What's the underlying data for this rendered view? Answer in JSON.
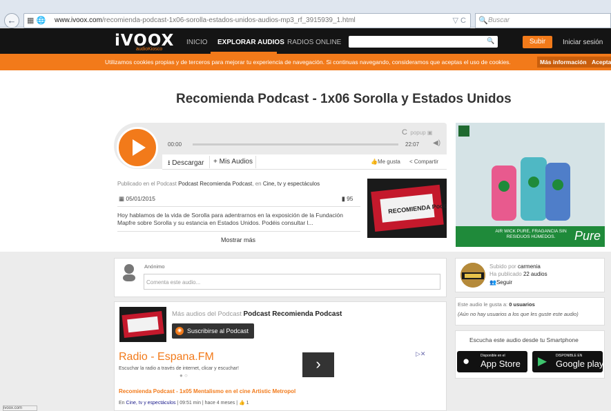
{
  "browser": {
    "url_domain": "www.ivoox.com",
    "url_path": "/recomienda-podcast-1x06-sorolla-estados-unidos-audios-mp3_rf_3915939_1.html",
    "search_placeholder": "Buscar",
    "back_glyph": "←",
    "reload_glyph": "▽ C"
  },
  "nav": {
    "logo": "iVOOX",
    "logo_sub": "audioKiosco",
    "links": [
      "INICIO",
      "EXPLORAR AUDIOS",
      "RADIOS ONLINE"
    ],
    "search_button": "🔍",
    "upload": "Subir",
    "login": "Iniciar sesión"
  },
  "cookies": {
    "text": "Utilizamos cookies propias y de terceros para mejorar tu experiencia de navegación. Si continuas navegando, consideramos que aceptas el uso de cookies.",
    "more_info": "Más información",
    "accept": "Aceptar"
  },
  "page": {
    "title": "Recomienda Podcast - 1x06 Sorolla y Estados Unidos"
  },
  "player": {
    "time_start": "00:00",
    "time_end": "22:07",
    "progress": 0,
    "popup_label": "popup",
    "download": "Descargar",
    "my_audios": "+ Mis Audios",
    "like": "Me gusta",
    "share": "Compartir"
  },
  "info": {
    "published_prefix": "Publicado en el Podcast",
    "podcast_name": "Podcast Recomienda Podcast",
    "category_prefix": "en",
    "category": "Cine, tv y espectáculos",
    "date": "05/01/2015",
    "plays": "95",
    "description": "Hoy hablamos de la vida de Sorolla para adentrarnos en la exposición de la Fundación Mapfre sobre Sorolla y su estancia en Estados Unidos. Podéis consultar l...",
    "show_more": "Mostrar más",
    "thumb_text": "RECOMIENDA Podcast"
  },
  "ad": {
    "band_text": "AIR WICK PURE, FRAGANCIA SIN RESIDUOS HÚMEDOS.",
    "brand": "Pure"
  },
  "comment": {
    "user": "Anónimo",
    "placeholder": "Comenta este audio..."
  },
  "more_audios": {
    "label": "Más audios del Podcast",
    "podcast": "Podcast Recomienda Podcast",
    "subscribe": "Suscribirse al Podcast"
  },
  "radio_ad": {
    "title": "Radio - Espana.FM",
    "subtitle": "Escuchar la radio a través de internet, clicar y escuchar!",
    "arrow": "›",
    "close": "▷✕"
  },
  "episode": {
    "title": "Recomienda Podcast - 1x05 Mentalismo en el cine Artistic Metropol",
    "prefix": "En",
    "category": "Cine, tv y espectáculos",
    "meta": "| 09:51 min | hace 4 meses | 👍 1"
  },
  "uploader": {
    "uploaded_by": "Subido por",
    "user": "carmenia",
    "has_published": "Ha publicado",
    "count": "22 audios",
    "follow": "Seguir"
  },
  "likes": {
    "prefix": "Este audio le gusta a:",
    "count": "0 usuarios",
    "note": "(Aún no hay usuarios a los que les guste este audio)"
  },
  "apps": {
    "title": "Escucha este audio desde tu Smartphone",
    "appstore_small": "Disponible en el",
    "appstore": "App Store",
    "google_small": "DISPONIBLE EN",
    "google": "Google play"
  },
  "status": {
    "text": "ivoox.com"
  }
}
